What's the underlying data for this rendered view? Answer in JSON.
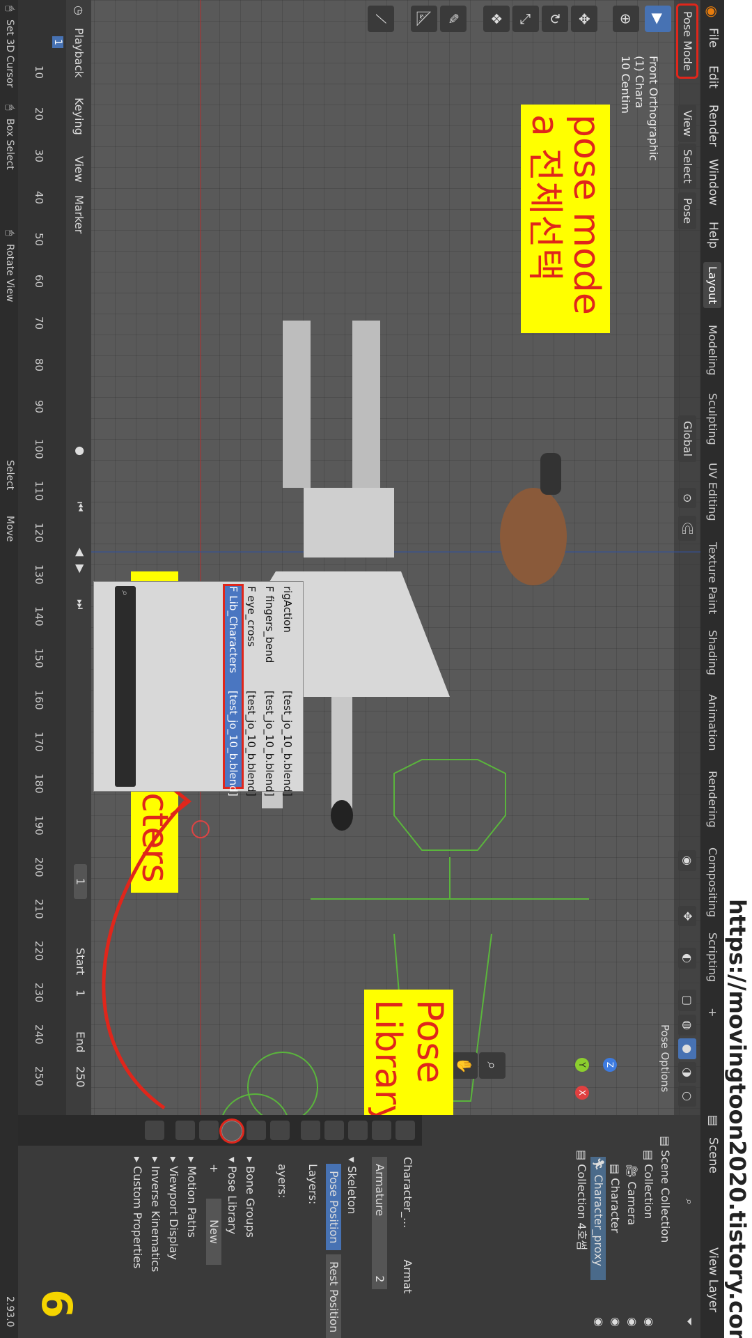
{
  "watermark": "https://movingtoon2020.tistory.com",
  "page_number": "6",
  "version": "2.93.0",
  "topbar": {
    "menus": [
      "File",
      "Edit",
      "Render",
      "Window",
      "Help"
    ],
    "workspaces": [
      "Layout",
      "Modeling",
      "Sculpting",
      "UV Editing",
      "Texture Paint",
      "Shading",
      "Animation",
      "Rendering",
      "Compositing",
      "Scripting"
    ],
    "active_workspace": "Layout",
    "scene": "Scene",
    "view_layer": "View Layer",
    "add_tab": "+"
  },
  "viewport": {
    "mode": "Pose Mode",
    "menus": [
      "View",
      "Select",
      "Pose"
    ],
    "orientation": "Global",
    "overlay_lines": [
      "Front Orthographic",
      "(1) Chara",
      "10 Centim"
    ],
    "gizmo_axes": {
      "x": "X",
      "y": "Y",
      "z": "Z"
    },
    "pose_options": "Pose Options"
  },
  "annotations": {
    "pose_mode_line1": "pose mode",
    "pose_mode_line2": "a 전체선택",
    "pose_library": "Pose Library",
    "flib": "F Lib_Characters"
  },
  "dropdown": {
    "items": [
      {
        "name": "rigAction",
        "file": "[test_jo_10_b.blend]",
        "selected": false
      },
      {
        "name": "F fingers_bend",
        "file": "[test_jo_10_b.blend]",
        "selected": false
      },
      {
        "name": "F eye_cross",
        "file": "[test_jo_10_b.blend]",
        "selected": false
      },
      {
        "name": "F Lib_Characters",
        "file": "[test_jo_10_b.blend]",
        "selected": true
      }
    ]
  },
  "timeline": {
    "menus": [
      "Playback",
      "Keying",
      "View",
      "Marker"
    ],
    "current_frame": "1",
    "start_label": "Start",
    "start": "1",
    "end_label": "End",
    "end": "250",
    "ticks": [
      "1",
      "10",
      "20",
      "30",
      "40",
      "50",
      "60",
      "70",
      "80",
      "90",
      "100",
      "110",
      "120",
      "130",
      "140",
      "150",
      "160",
      "170",
      "180",
      "190",
      "200",
      "210",
      "220",
      "230",
      "240",
      "250"
    ]
  },
  "statusbar": {
    "items": [
      "Set 3D Cursor",
      "Box Select",
      "Rotate View",
      "Select",
      "Move"
    ]
  },
  "outliner": {
    "rows": [
      "Scene Collection",
      "Collection",
      "Camera",
      "Character",
      "Character_proxy",
      "Collection 4호썸"
    ]
  },
  "properties": {
    "object_name": "Character_...",
    "data_name": "Armat",
    "armature_field": "Armature",
    "users": "2",
    "skeleton": "Skeleton",
    "pose_position": "Pose Position",
    "rest_position": "Rest Position",
    "layers": "Layers:",
    "protected_layers": "ayers:",
    "sections": [
      "Bone Groups",
      "Pose Library",
      "Motion Paths",
      "Viewport Display",
      "Inverse Kinematics",
      "Custom Properties"
    ],
    "new_button": "New",
    "plus": "+"
  },
  "colors": {
    "annotation_bg": "#ffff00",
    "annotation_text": "#e0261b",
    "selection": "#4a76c1"
  }
}
